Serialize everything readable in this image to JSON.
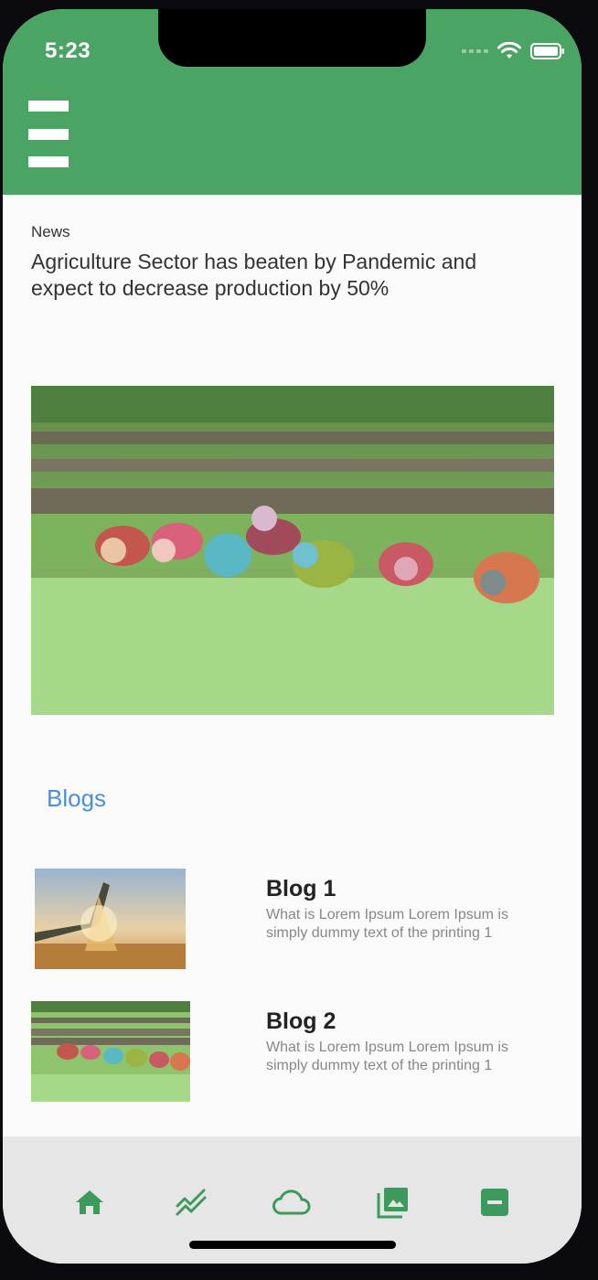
{
  "status_bar": {
    "time": "5:23"
  },
  "colors": {
    "accent": "#4aa565",
    "link": "#4a90d9",
    "nav_bg": "#e6e6e6"
  },
  "header": {
    "menu_icon": "hamburger-menu-icon"
  },
  "news": {
    "label": "News",
    "title": "Agriculture Sector has beaten by Pandemic and expect to decrease production by 50%",
    "image_icon": "rice-field-photo"
  },
  "blogs": {
    "heading": "Blogs",
    "items": [
      {
        "title": "Blog 1",
        "description": "What is Lorem Ipsum Lorem Ipsum is simply dummy text of the printing 1"
      },
      {
        "title": "Blog 2",
        "description": "What is Lorem Ipsum Lorem Ipsum is simply dummy text of the printing 1"
      }
    ]
  },
  "bottom_nav": {
    "items": [
      {
        "icon": "home-icon"
      },
      {
        "icon": "trend-chart-icon"
      },
      {
        "icon": "cloud-icon"
      },
      {
        "icon": "gallery-icon"
      },
      {
        "icon": "minus-box-icon"
      }
    ]
  }
}
